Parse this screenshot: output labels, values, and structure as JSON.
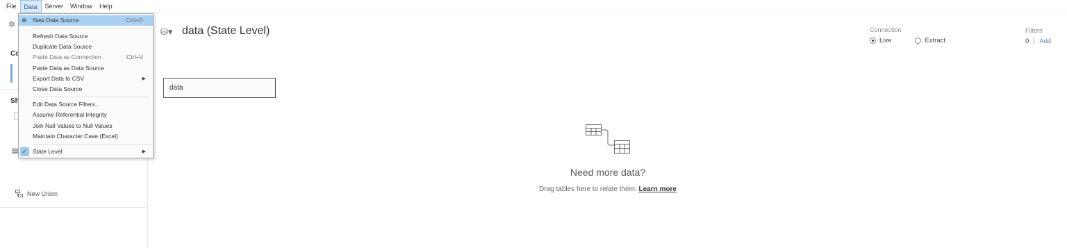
{
  "menubar": {
    "items": [
      "File",
      "Data",
      "Server",
      "Window",
      "Help"
    ],
    "active": "Data"
  },
  "left_pane": {
    "connections_label": "Co",
    "sheets_label": "Sh",
    "new_union_label": "New Union"
  },
  "data_menu": {
    "new_data_source": {
      "label": "New Data Source",
      "shortcut": "Ctrl+D"
    },
    "refresh_data_source": "Refresh Data Source",
    "duplicate_data_source": "Duplicate Data Source",
    "paste_data_as_connection": {
      "label": "Paste Data as Connection",
      "shortcut": "Ctrl+V"
    },
    "paste_data_as_data_source": "Paste Data as Data Source",
    "export_data_to_csv": "Export Data to CSV",
    "close_data_source": "Close Data Source",
    "edit_data_source_filters": "Edit Data Source Filters...",
    "assume_referential_integrity": "Assume Referential Integrity",
    "join_null_values": "Join Null Values to Null Values",
    "maintain_character_case": "Maintain Character Case (Excel)",
    "state_level": "State Level"
  },
  "data_source": {
    "title": "data (State Level)",
    "table_name": "data"
  },
  "connection": {
    "label": "Connection",
    "live": "Live",
    "extract": "Extract",
    "selected": "Live"
  },
  "filters": {
    "label": "Filters",
    "count": "0",
    "add": "Add"
  },
  "empty_canvas": {
    "heading": "Need more data?",
    "hint": "Drag tables here to relate them.",
    "learn_more": "Learn more"
  },
  "colors": {
    "menu_highlight": "#a9d1f2",
    "link": "#5a87b5",
    "active_menu_bg": "#dbe9f6"
  }
}
